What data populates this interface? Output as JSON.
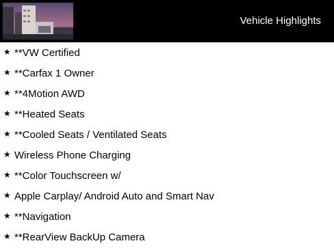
{
  "header": {
    "title": "Vehicle Highlights",
    "background_color": "#000000",
    "text_color": "#ffffff"
  },
  "thumbnail": {
    "icon": "dealership-photo"
  },
  "highlights": {
    "bullet_icon": "star-icon",
    "items": [
      {
        "label": "**VW Certified"
      },
      {
        "label": "**Carfax 1 Owner"
      },
      {
        "label": "**4Motion AWD"
      },
      {
        "label": "**Heated Seats"
      },
      {
        "label": "**Cooled Seats / Ventilated Seats"
      },
      {
        "label": "Wireless Phone Charging"
      },
      {
        "label": "**Color Touchscreen w/"
      },
      {
        "label": "Apple Carplay/ Android Auto and Smart Nav"
      },
      {
        "label": "**Navigation"
      },
      {
        "label": "**RearView BackUp Camera"
      }
    ]
  }
}
